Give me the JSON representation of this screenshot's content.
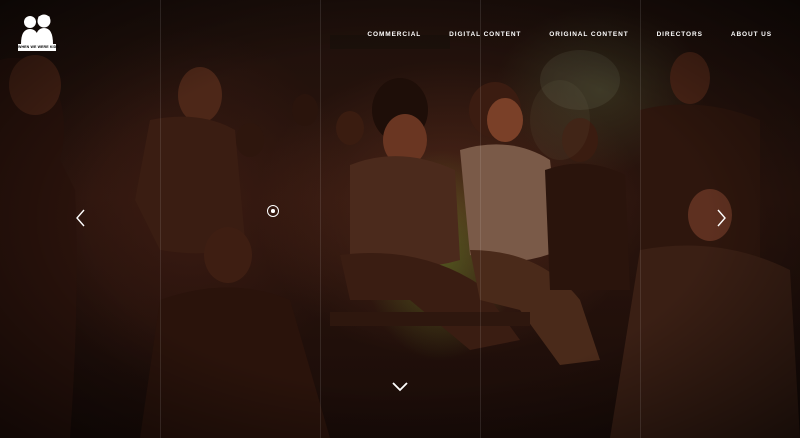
{
  "brand": {
    "logo_text": "WHEN WE WERE KIDS",
    "logo_icon": "two-children-silhouette-icon"
  },
  "nav": {
    "items": [
      {
        "label": "COMMERCIAL"
      },
      {
        "label": "DIGITAL CONTENT"
      },
      {
        "label": "ORIGINAL CONTENT"
      },
      {
        "label": "DIRECTORS"
      },
      {
        "label": "ABOUT US"
      }
    ]
  },
  "hero": {
    "image": "smoky-bar-scene-photo",
    "prev_icon": "chevron-left-icon",
    "next_icon": "chevron-right-icon",
    "indicator_icon": "circle-dot-icon",
    "scroll_icon": "chevron-down-icon"
  },
  "colors": {
    "nav_text": "#ffffff",
    "background": "#140b08",
    "grid_line": "rgba(255,255,255,0.10)"
  }
}
